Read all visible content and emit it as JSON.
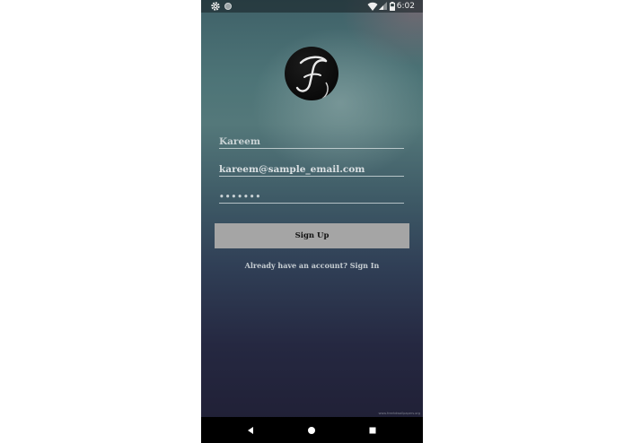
{
  "status_bar": {
    "time": "6:02",
    "icons": [
      "gear-icon",
      "circle-notification-icon",
      "wifi-icon",
      "cell-signal-icon",
      "battery-icon"
    ]
  },
  "logo": {
    "icon": "script-f-logo"
  },
  "form": {
    "name": {
      "value": "Kareem",
      "placeholder": "Kareem"
    },
    "email": {
      "value": "kareem@sample_email.com"
    },
    "password": {
      "value": "•••••••"
    },
    "signup_label": "Sign Up",
    "signin_text": "Already have an account? Sign In"
  },
  "watermark": "www.freehdwallpapers.org",
  "nav_bar": {
    "icons": [
      "back-icon",
      "home-icon",
      "recents-icon"
    ]
  },
  "colors": {
    "button_bg": "#a5a5a5",
    "button_text": "#111111",
    "nav_bg": "#000000"
  }
}
